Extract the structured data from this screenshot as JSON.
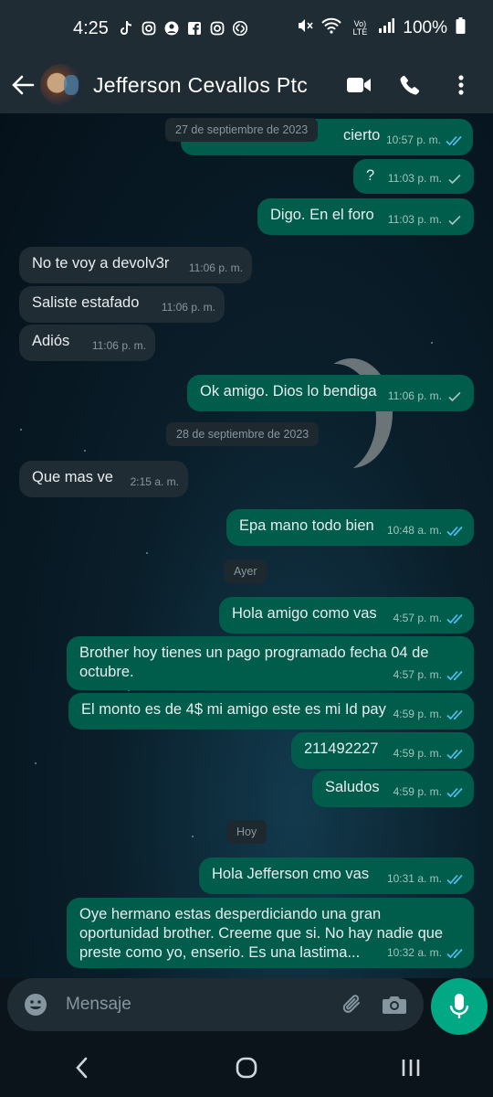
{
  "status_bar": {
    "time": "4:25",
    "battery": "100%",
    "network": "Vo) LTE",
    "left_icons": [
      "tiktok-icon",
      "instagram-icon",
      "person-icon",
      "facebook-icon",
      "instagram-icon",
      "shazam-icon"
    ],
    "right_icons": [
      "mute-icon",
      "wifi-icon",
      "volte-icon",
      "signal-icon",
      "battery-icon"
    ]
  },
  "header": {
    "contact_name": "Jefferson Cevallos Ptc",
    "icons": [
      "back-arrow-icon",
      "video-call-icon",
      "voice-call-icon",
      "more-options-icon"
    ]
  },
  "messages": [
    {
      "type": "out",
      "text": "cierto",
      "time": "10:57 p. m.",
      "status": "read"
    },
    {
      "type": "date",
      "text": "27 de septiembre de 2023"
    },
    {
      "type": "out",
      "text": "?",
      "time": "11:03 p. m.",
      "status": "sent"
    },
    {
      "type": "out",
      "text": "Digo. En el foro",
      "time": "11:03 p. m.",
      "status": "sent"
    },
    {
      "type": "in",
      "text": "No te voy a devolv3r",
      "time": "11:06 p. m."
    },
    {
      "type": "in",
      "text": "Saliste estafado",
      "time": "11:06 p. m."
    },
    {
      "type": "in",
      "text": "Adiós",
      "time": "11:06 p. m."
    },
    {
      "type": "out",
      "text": "Ok amigo. Dios lo bendiga",
      "time": "11:06 p. m.",
      "status": "sent"
    },
    {
      "type": "date",
      "text": "28 de septiembre de 2023"
    },
    {
      "type": "in",
      "text": "Que mas ve",
      "time": "2:15 a. m."
    },
    {
      "type": "out",
      "text": "Epa mano todo bien",
      "time": "10:48 a. m.",
      "status": "read"
    },
    {
      "type": "date",
      "text": "Ayer"
    },
    {
      "type": "out",
      "text": "Hola amigo como vas",
      "time": "4:57 p. m.",
      "status": "read"
    },
    {
      "type": "out",
      "text": "Brother hoy tienes un pago programado fecha 04 de octubre.",
      "time": "4:57 p. m.",
      "status": "read"
    },
    {
      "type": "out",
      "text": "El monto es de 4$ mi amigo este es mi Id pay",
      "time": "4:59 p. m.",
      "status": "read"
    },
    {
      "type": "out",
      "text": "211492227",
      "time": "4:59 p. m.",
      "status": "read"
    },
    {
      "type": "out",
      "text": "Saludos",
      "time": "4:59 p. m.",
      "status": "read"
    },
    {
      "type": "date",
      "text": "Hoy"
    },
    {
      "type": "out",
      "text": "Hola Jefferson cmo vas",
      "time": "10:31 a. m.",
      "status": "read"
    },
    {
      "type": "out",
      "text": "Oye hermano estas desperdiciando una gran oportunidad brother. Creeme que si. No hay nadie que preste como yo, enserio. Es una lastima...",
      "time": "10:32 a. m.",
      "status": "read"
    }
  ],
  "composer": {
    "placeholder": "Mensaje",
    "icons": [
      "emoji-icon",
      "attach-icon",
      "camera-icon",
      "mic-icon"
    ]
  },
  "colors": {
    "outgoing_bubble": "#005c4b",
    "incoming_bubble": "#202c33",
    "read_tick": "#53bdeb",
    "accent": "#00a884"
  }
}
